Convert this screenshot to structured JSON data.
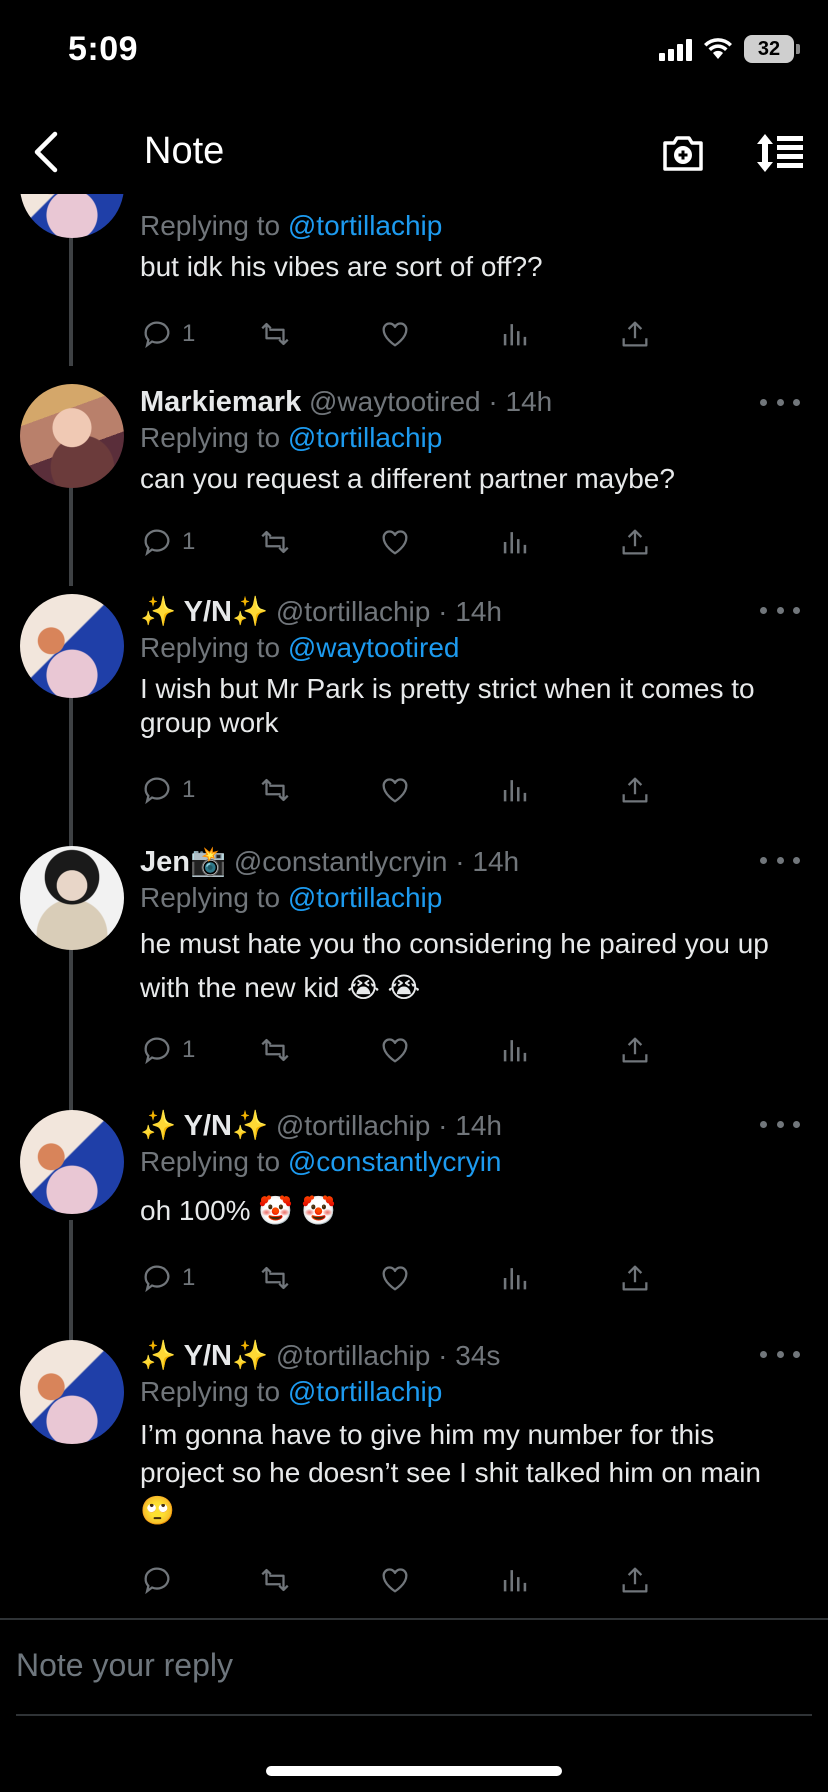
{
  "status_bar": {
    "time": "5:09",
    "battery": "32"
  },
  "header": {
    "title": "Note"
  },
  "replies": [
    {
      "replying_label": "Replying to",
      "replying_to": "@tortillachip",
      "text": "but idk his vibes are sort of off??",
      "reply_count": "1"
    },
    {
      "name": "Markiemark",
      "handle": "@waytootired",
      "time": "· 14h",
      "replying_label": "Replying to",
      "replying_to": "@tortillachip",
      "text": "can you request a different partner maybe?",
      "reply_count": "1"
    },
    {
      "name": "✨ Y/N✨",
      "handle": "@tortillachip",
      "time": "· 14h",
      "replying_label": "Replying to",
      "replying_to": "@waytootired",
      "text": "I wish but Mr Park is pretty strict when it comes to group work",
      "reply_count": "1"
    },
    {
      "name": "Jen📸",
      "handle": "@constantlycryin",
      "time": "· 14h",
      "replying_label": "Replying to",
      "replying_to": "@tortillachip",
      "text": "he must hate you tho considering he paired you up with the new kid 😭 😭",
      "reply_count": "1"
    },
    {
      "name": "✨ Y/N✨",
      "handle": "@tortillachip",
      "time": "· 14h",
      "replying_label": "Replying to",
      "replying_to": "@constantlycryin",
      "text": "oh 100% 🤡 🤡",
      "reply_count": "1"
    },
    {
      "name": "✨ Y/N✨",
      "handle": "@tortillachip",
      "time": "· 34s",
      "replying_label": "Replying to",
      "replying_to": "@tortillachip",
      "text": "I’m gonna have to give him my number for this project so he doesn’t see I shit talked him on main 🙄",
      "reply_count": ""
    }
  ],
  "reply_box": {
    "placeholder": "Note your reply"
  },
  "icons": {
    "back": "chevron-left-icon",
    "camera": "camera-plus-icon",
    "sort": "sort-icon",
    "reply": "comment-icon",
    "retweet": "retweet-icon",
    "like": "heart-icon",
    "views": "analytics-icon",
    "share": "share-icon",
    "more": "more-dots-icon"
  },
  "colors": {
    "background": "#000000",
    "mention": "#1d9bf0",
    "muted": "#71767b",
    "text": "#e7e9ea"
  }
}
